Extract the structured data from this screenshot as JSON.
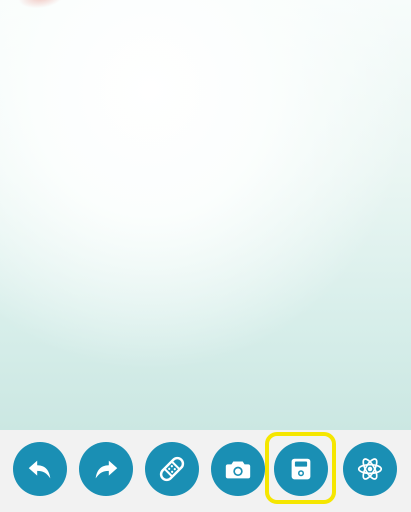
{
  "toolbar": {
    "selected": "save",
    "accent_color": "#1a8fb4",
    "highlight_color": "#f5e600",
    "buttons": [
      {
        "id": "undo",
        "icon": "undo-arrow-icon"
      },
      {
        "id": "redo",
        "icon": "redo-arrow-icon"
      },
      {
        "id": "bandage",
        "icon": "bandage-icon"
      },
      {
        "id": "camera",
        "icon": "camera-icon"
      },
      {
        "id": "save",
        "icon": "save-floppy-icon"
      },
      {
        "id": "atom",
        "icon": "atom-icon"
      }
    ]
  }
}
